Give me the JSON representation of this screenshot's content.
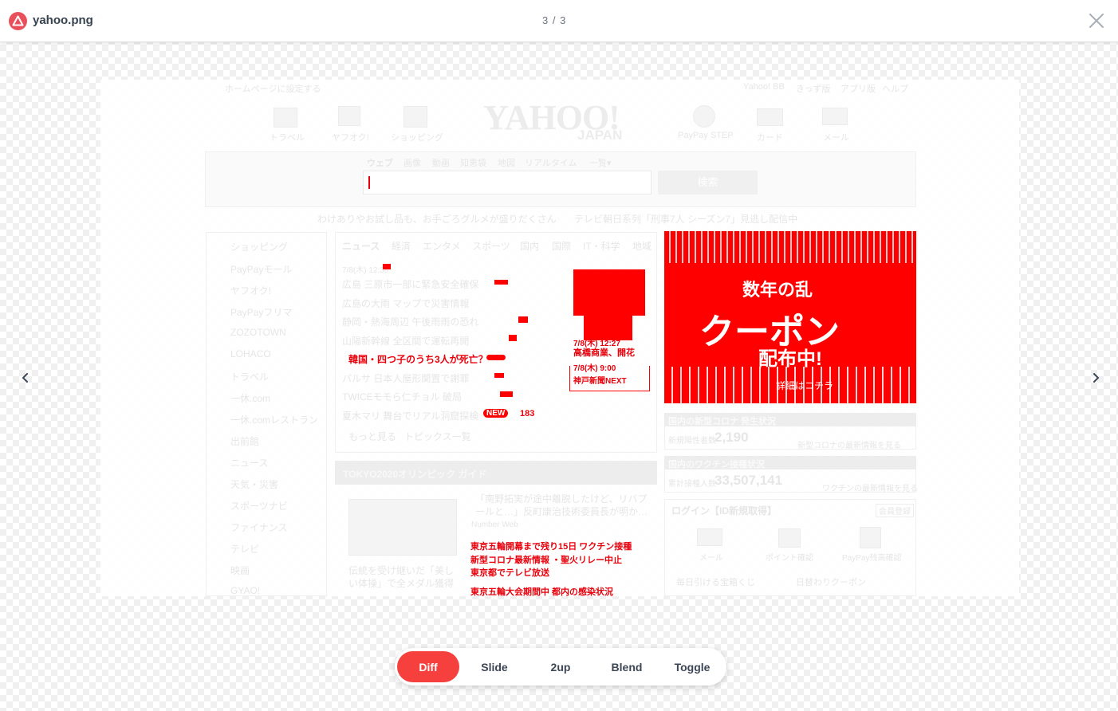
{
  "header": {
    "file_name": "yahoo.png",
    "counter": "3 / 3"
  },
  "toolbar": {
    "modes": [
      "Diff",
      "Slide",
      "2up",
      "Blend",
      "Toggle"
    ],
    "active": "Diff"
  },
  "colors": {
    "accent": "#f5403d",
    "diff": "#ff0000",
    "logo": "#e8505b"
  },
  "icons": {
    "logo": "warning-triangle-icon",
    "close": "close-icon",
    "prev": "chevron-left-icon",
    "next": "chevron-right-icon"
  },
  "preview": {
    "top_link": "ホームページに設定する",
    "top_right": [
      "Yahoo! BB",
      "きっず版",
      "アプリ版",
      "ヘルプ"
    ],
    "services": [
      "トラベル",
      "ヤフオク!",
      "ショッピング",
      "PayPay STEP",
      "カード",
      "メール"
    ],
    "brand": {
      "main": "YAHOO!",
      "sub": "JAPAN"
    },
    "search_tabs": [
      "ウェブ",
      "画像",
      "動画",
      "知恵袋",
      "地図",
      "リアルタイム",
      "一覧▾"
    ],
    "search_button": "検索",
    "promo": [
      "わけありやお試し品も、お手ごろグルメが盛りだくさん",
      "テレビ朝日系列「刑事7人 シーズン7」見逃し配信中"
    ],
    "sidebar": [
      "ショッピング",
      "PayPayモール",
      "ヤフオク!",
      "PayPayフリマ",
      "ZOZOTOWN",
      "LOHACO",
      "トラベル",
      "一休.com",
      "一休.comレストラン",
      "出前館",
      "ニュース",
      "天気・災害",
      "スポーツナビ",
      "ファイナンス",
      "テレビ",
      "映画",
      "GYAO!"
    ],
    "news_tabs": [
      "ニュース",
      "経済",
      "エンタメ",
      "スポーツ",
      "国内",
      "国際",
      "IT・科学",
      "地域"
    ],
    "news_timestamp": "7/8(木) 12:38",
    "news": [
      "広島 三原市一部に緊急安全確保",
      "広島の大雨 マップで災害情報",
      "静岡・熱海周辺 午後雨雨の恐れ",
      "山陽新幹線 全区間で運転再開",
      "韓国・四つ子のうち3人が死亡？",
      "パルサ 日本人屋形関置で謝罪",
      "TWICEモモら仁チョル 破局",
      "夏木マリ 舞台でリアル洞窟探検"
    ],
    "news_more": [
      "もっと見る",
      "トピックス一覧"
    ],
    "olympics": {
      "title": "TOKYO2020オリンピック ガイド",
      "article1": "「南野拓実が途中離脱したけど、リバプールと…」反町康治技術委員長が明か…",
      "source1": "Number Web",
      "caption": "伝統を受け継いだ「美しい体操」で全メダル獲得"
    },
    "side_news": {
      "time1": "7/8(木) 12:27",
      "title1": "高橋商業、開花",
      "time2": "7/8(木) 9:00",
      "source2": "神戸新聞NEXT"
    },
    "ad_text": {
      "line1": "数年の乱",
      "main": "クーポン",
      "sub": "配布中!",
      "link": "詳細はコチラ"
    },
    "covid": {
      "title": "国内の新型コロナ 発生状況",
      "label": "新規陽性者数",
      "number": "2,190",
      "link": "新型コロナの最新情報を見る"
    },
    "vaccine": {
      "title": "国内のワクチン接種状況",
      "label": "累計接種人数",
      "number": "33,507,141",
      "link": "ワクチンの最新情報を見る"
    },
    "login": {
      "title": "ログイン【ID新規取得】",
      "badge": "会員登録",
      "items": [
        "メール",
        "ポイント確認",
        "PayPay残高確認"
      ],
      "footer": [
        "毎日引ける宝箱くじ",
        "日替わりクーポン"
      ]
    },
    "diff_labels": [
      "7/8(木) 12:27",
      "高橋商業、開花",
      "7/8(木) 9:00",
      "神戸新聞NEXT",
      "NEW",
      "183",
      "東京五輪開幕まで残り15日 ワクチン接種",
      "新型コロナ最新情報 ・聖火リレー中止",
      "東京都でテレビ放送",
      "東京五輪大会期間中 都内の感染状況"
    ]
  }
}
